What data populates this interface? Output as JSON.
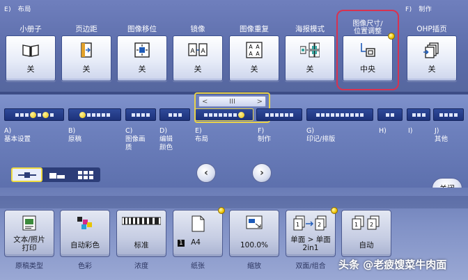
{
  "header": {
    "section_left": "E)　布局",
    "section_right": "F)　制作"
  },
  "functions": [
    {
      "label": "小册子",
      "value": "关",
      "icon": "booklet-icon"
    },
    {
      "label": "页边距",
      "value": "关",
      "icon": "page-margin-icon"
    },
    {
      "label": "图像移位",
      "value": "关",
      "icon": "image-shift-icon"
    },
    {
      "label": "镜像",
      "value": "关",
      "icon": "mirror-icon"
    },
    {
      "label": "图像重复",
      "value": "关",
      "icon": "image-repeat-icon"
    },
    {
      "label": "海报模式",
      "value": "关",
      "icon": "poster-mode-icon"
    },
    {
      "label_line1": "图像尺寸/",
      "label_line2": "位置调整",
      "value": "中央",
      "icon": "image-size-position-icon"
    },
    {
      "label": "OHP插页",
      "value": "关",
      "icon": "ohp-interleave-icon"
    }
  ],
  "scroller": {
    "left": "<",
    "mid": "III",
    "right": ">"
  },
  "tabs": [
    {
      "caption": "A)\n基本设置"
    },
    {
      "caption": "B)\n原稿"
    },
    {
      "caption": "C)\n图像画\n质"
    },
    {
      "caption": "D)\n编辑\n颜色"
    },
    {
      "caption": "E)\n布局"
    },
    {
      "caption": "F)\n制作"
    },
    {
      "caption": "G)\n印记/排版"
    },
    {
      "caption": "H)"
    },
    {
      "caption": "I)"
    },
    {
      "caption": "J)\n其他"
    }
  ],
  "nav": {
    "prev": "‹",
    "next": "›",
    "close_label": "关闭"
  },
  "quick": [
    {
      "value": "文本/照片\n打印",
      "caption": "原稿类型"
    },
    {
      "value": "自动彩色",
      "caption": "色彩"
    },
    {
      "value": "标准",
      "caption": "浓度"
    },
    {
      "value": "A4",
      "tray": "1",
      "caption": "纸张"
    },
    {
      "value": "100.0%",
      "caption": "缩放"
    },
    {
      "value": "单面 > 单面\n2in1",
      "caption": "双面/组合"
    },
    {
      "value": "自动",
      "caption": ""
    }
  ],
  "watermark": "头条 @老疲馊菜牛肉面"
}
